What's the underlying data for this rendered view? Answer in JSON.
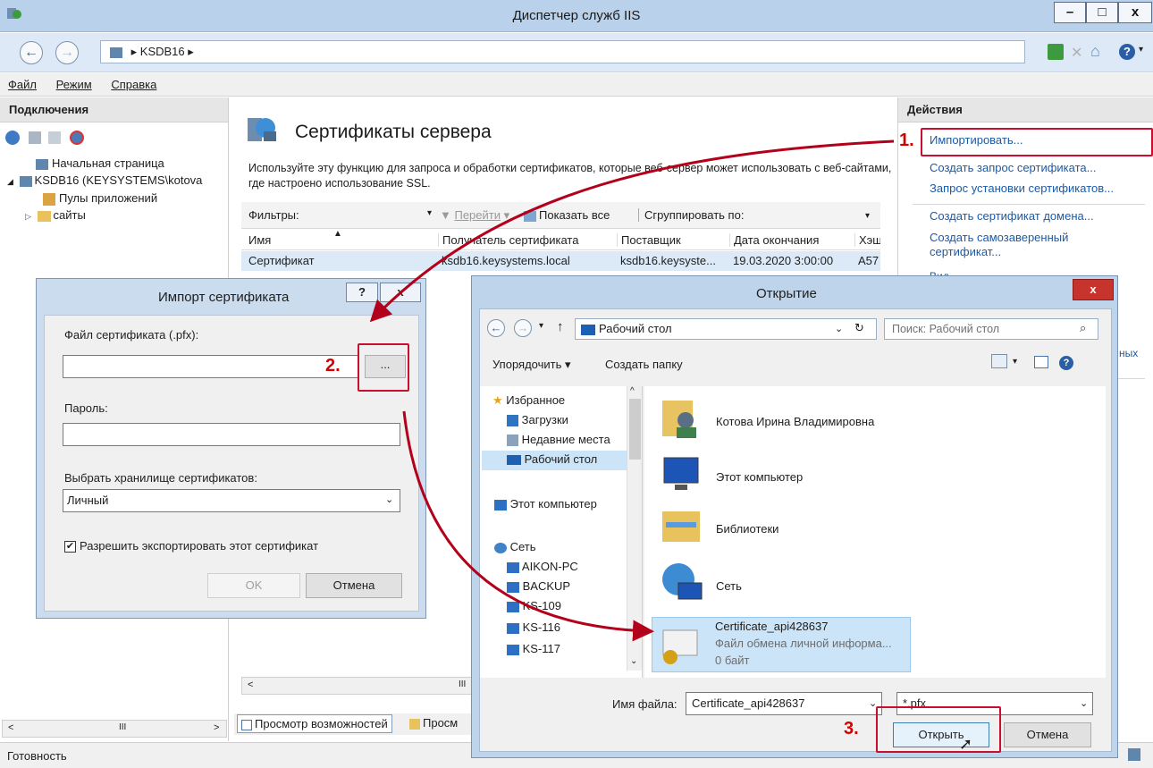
{
  "window": {
    "title": "Диспетчер служб IIS",
    "minimize": "–",
    "maximize": "□",
    "close": "x"
  },
  "address": {
    "icon": "server-icon",
    "path": "KSDB16"
  },
  "menu": [
    "Файл",
    "Режим",
    "Справка"
  ],
  "connections": {
    "title": "Подключения",
    "items": [
      "Начальная страница",
      "KSDB16 (KEYSYSTEMS\\kotova",
      "Пулы приложений",
      "сайты"
    ]
  },
  "main": {
    "title": "Сертификаты сервера",
    "description": "Используйте эту функцию для запроса и обработки сертификатов, которые веб-сервер может использовать с веб-сайтами, где настроено использование SSL.",
    "filter_label": "Фильтры:",
    "go_label": "Перейти",
    "show_all_label": "Показать все",
    "group_by_label": "Сгруппировать по:",
    "columns": [
      "Имя",
      "Получатель сертификата",
      "Поставщик",
      "Дата окончания",
      "Хэш"
    ],
    "rows": [
      [
        "Сертификат",
        "ksdb16.keysystems.local",
        "ksdb16.keysyste...",
        "19.03.2020 3:00:00",
        "A57"
      ]
    ],
    "features_view": "Просмотр возможностей",
    "content_view": "Просм"
  },
  "actions": {
    "title": "Действия",
    "items": [
      "Импортировать...",
      "Создать запрос сертификата...",
      "Запрос установки сертификатов...",
      "Создать сертификат домена...",
      "Создать самозаверенный сертификат...",
      "Вид"
    ],
    "partial": "ных"
  },
  "status": {
    "text": "Готовность"
  },
  "import_dialog": {
    "title": "Импорт сертификата",
    "help": "?",
    "close": "x",
    "file_label": "Файл сертификата (.pfx):",
    "file_value": "",
    "browse": "...",
    "password_label": "Пароль:",
    "password_value": "",
    "store_label": "Выбрать хранилище сертификатов:",
    "store_value": "Личный",
    "export_label": "Разрешить экспортировать этот сертификат",
    "export_checked": true,
    "ok": "OK",
    "cancel": "Отмена"
  },
  "open_dialog": {
    "title": "Открытие",
    "close": "x",
    "location": "Рабочий стол",
    "search_placeholder": "Поиск: Рабочий стол",
    "organize": "Упорядочить",
    "new_folder": "Создать папку",
    "nav": {
      "favorites": "Избранное",
      "fav_items": [
        "Загрузки",
        "Недавние места",
        "Рабочий стол"
      ],
      "computer": "Этот компьютер",
      "network": "Сеть",
      "net_items": [
        "AIKON-PC",
        "BACKUP",
        "KS-109",
        "KS-116",
        "KS-117"
      ]
    },
    "files": [
      {
        "name": "Котова Ирина Владимировна"
      },
      {
        "name": "Этот компьютер"
      },
      {
        "name": "Библиотеки"
      },
      {
        "name": "Сеть"
      },
      {
        "name": "Certificate_api428637",
        "type": "Файл обмена личной информа...",
        "size": "0 байт"
      }
    ],
    "filename_label": "Имя файла:",
    "filename_value": "Certificate_api428637",
    "filetype_value": "*.pfx",
    "open": "Открыть",
    "cancel": "Отмена"
  },
  "annotations": [
    "1.",
    "2.",
    "3."
  ],
  "colors": {
    "accent_red": "#c8102e",
    "link_blue": "#1c5aa6",
    "selection": "#cce4f7"
  }
}
